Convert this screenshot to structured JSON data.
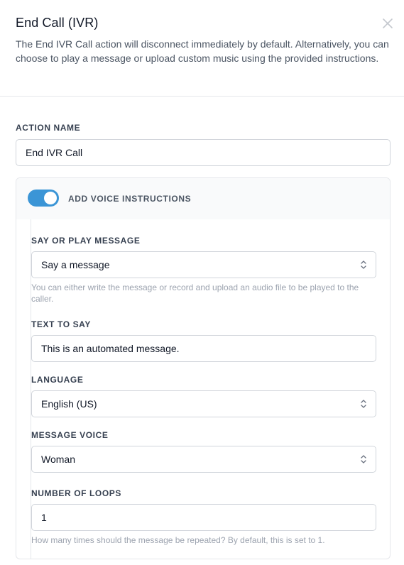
{
  "modal": {
    "title": "End Call (IVR)",
    "description": "The End IVR Call action will disconnect immediately by default. Alternatively, you can choose to play a message or upload custom music using the provided instructions."
  },
  "action_name": {
    "label": "ACTION NAME",
    "value": "End IVR Call"
  },
  "voice_instructions": {
    "toggle_label": "ADD VOICE INSTRUCTIONS",
    "enabled": true
  },
  "say_or_play": {
    "label": "SAY OR PLAY MESSAGE",
    "selected": "Say a message",
    "help": "You can either write the message or record and upload an audio file to be played to the caller."
  },
  "text_to_say": {
    "label": "TEXT TO SAY",
    "value": "This is an automated message."
  },
  "language": {
    "label": "LANGUAGE",
    "selected": "English (US)"
  },
  "message_voice": {
    "label": "MESSAGE VOICE",
    "selected": "Woman"
  },
  "loops": {
    "label": "NUMBER OF LOOPS",
    "value": "1",
    "help": "How many times should the message be repeated? By default, this is set to 1."
  },
  "colors": {
    "accent": "#3b95d6",
    "border": "#d1d5db",
    "muted_text": "#9ca3af"
  },
  "icons": {
    "close": "close-icon",
    "select": "chevron-updown-icon"
  }
}
